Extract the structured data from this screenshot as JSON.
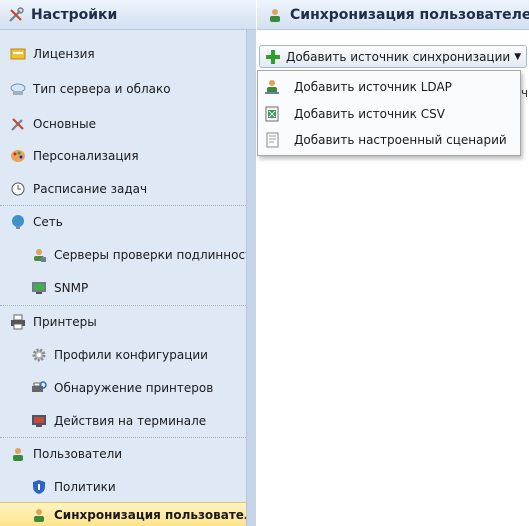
{
  "sidebar": {
    "title": "Настройки",
    "items": [
      {
        "label": "Лицензия",
        "icon": "license-icon"
      },
      {
        "label": "Тип сервера и облако",
        "icon": "cloud-server-icon"
      },
      {
        "label": "Основные",
        "icon": "tools-icon"
      },
      {
        "label": "Персонализация",
        "icon": "palette-icon"
      },
      {
        "label": "Расписание задач",
        "icon": "clock-icon"
      },
      {
        "label": "Сеть",
        "icon": "network-icon"
      },
      {
        "label": "Серверы проверки подлинности",
        "icon": "user-server-icon"
      },
      {
        "label": "SNMP",
        "icon": "snmp-monitor-icon"
      },
      {
        "label": "Принтеры",
        "icon": "printer-icon"
      },
      {
        "label": "Профили конфигурации",
        "icon": "gear-profile-icon"
      },
      {
        "label": "Обнаружение принтеров",
        "icon": "printer-discovery-icon"
      },
      {
        "label": "Действия на терминале",
        "icon": "terminal-icon"
      },
      {
        "label": "Пользователи",
        "icon": "users-icon"
      },
      {
        "label": "Политики",
        "icon": "shield-icon"
      },
      {
        "label": "Синхронизация пользователей",
        "icon": "user-sync-icon"
      }
    ]
  },
  "main": {
    "title": "Синхронизация пользователей",
    "add_button_label": "Добавить источник синхронизации",
    "obscured_text": "чн"
  },
  "dropdown": {
    "items": [
      {
        "label": "Добавить источник LDAP",
        "icon": "ldap-user-icon"
      },
      {
        "label": "Добавить источник CSV",
        "icon": "csv-file-icon"
      },
      {
        "label": "Добавить настроенный сценарий",
        "icon": "script-file-icon"
      }
    ]
  },
  "colors": {
    "sidebar_bg": "#dfe9f6",
    "selected_bg": "#fde48a",
    "accent_green": "#2f9e2f"
  }
}
